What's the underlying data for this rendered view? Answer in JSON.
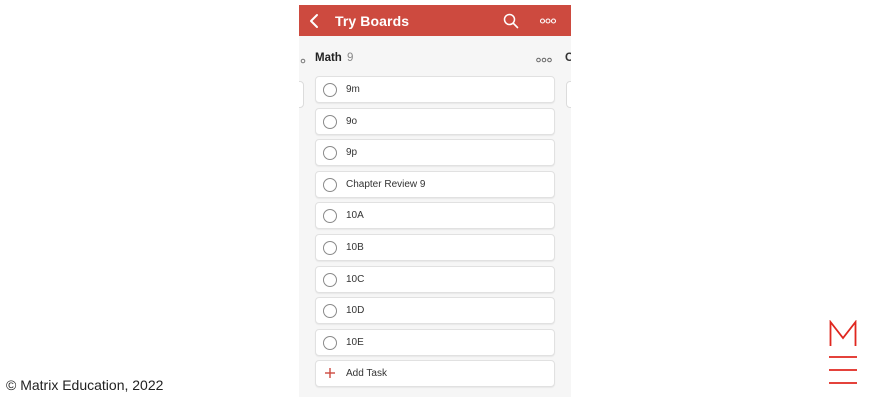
{
  "app": {
    "title": "Try Boards"
  },
  "icons": {
    "back": "chevron-left-icon",
    "search": "search-icon",
    "more": "more-dots-icon",
    "add": "plus-icon"
  },
  "colors": {
    "accent": "#cd4a3f",
    "logo": "#e0271f"
  },
  "section": {
    "name": "Math",
    "count": "9",
    "next_peek": "C"
  },
  "tasks": [
    {
      "label": "9m"
    },
    {
      "label": "9o"
    },
    {
      "label": "9p"
    },
    {
      "label": "Chapter Review 9"
    },
    {
      "label": "10A"
    },
    {
      "label": "10B"
    },
    {
      "label": "10C"
    },
    {
      "label": "10D"
    },
    {
      "label": "10E"
    }
  ],
  "add_task": {
    "label": "Add Task"
  },
  "footer": {
    "copyright": "© Matrix Education, 2022"
  },
  "logo": {
    "letter": "M"
  }
}
